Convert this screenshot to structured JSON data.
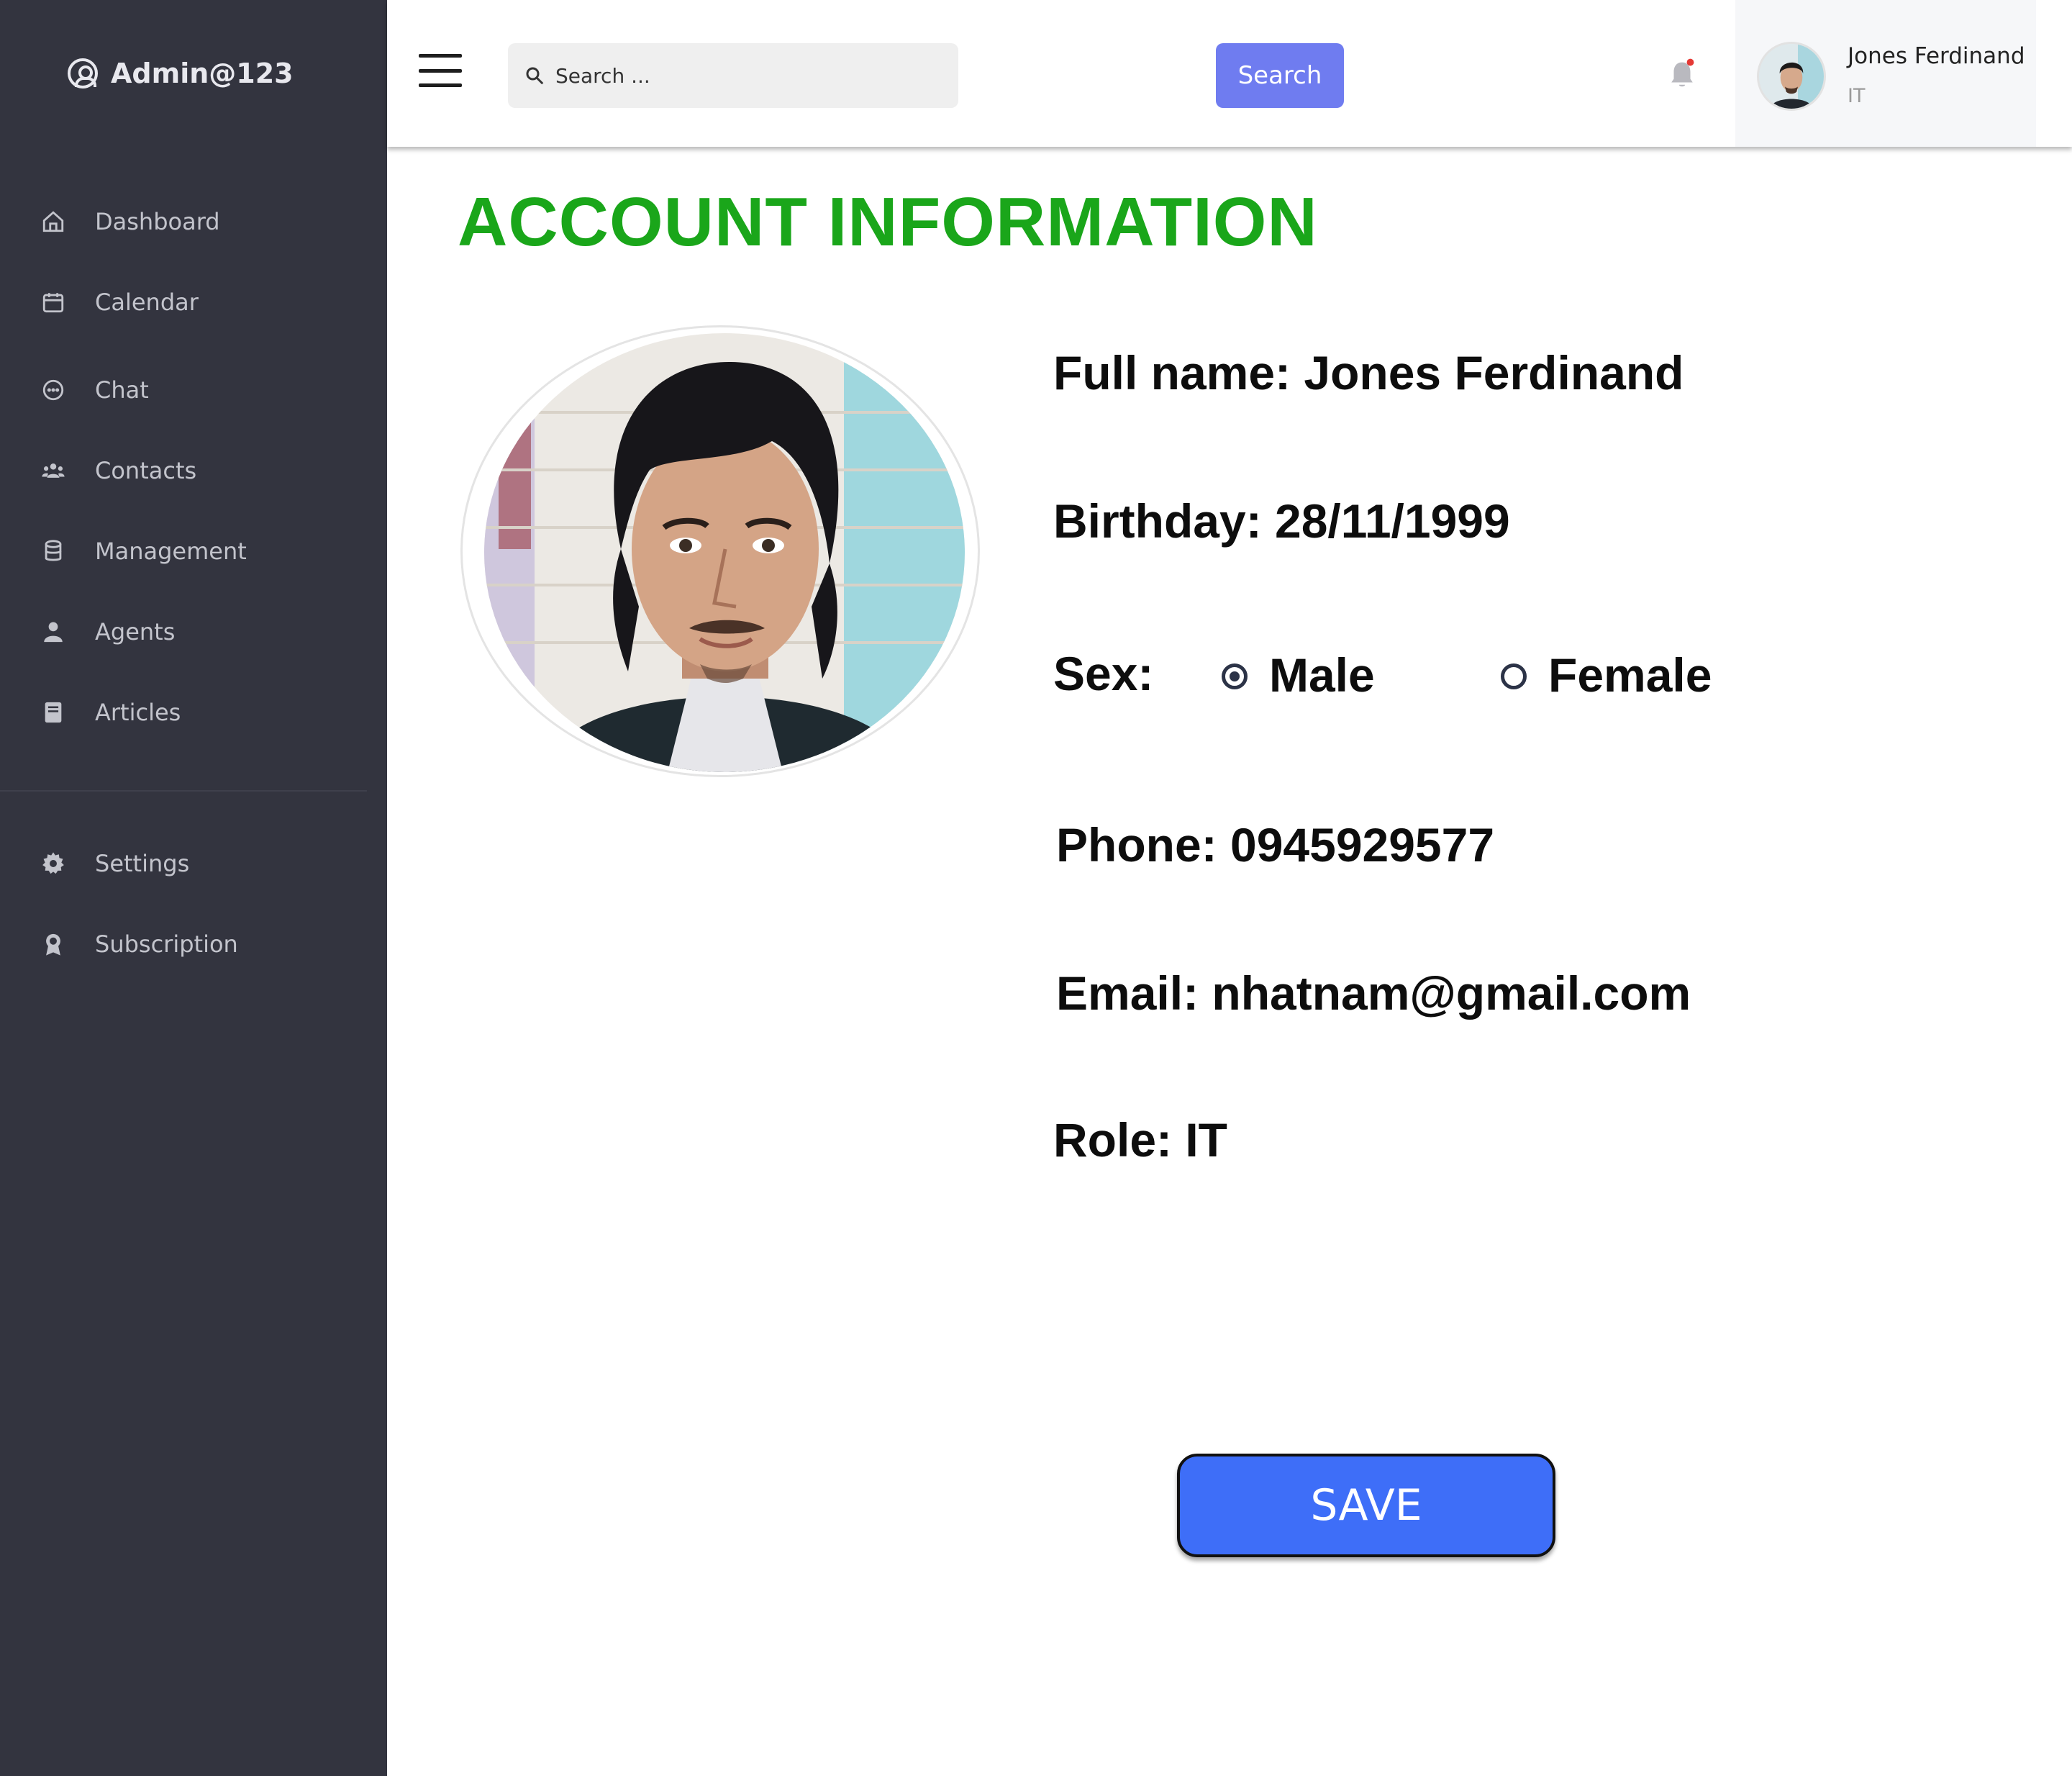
{
  "sidebar": {
    "brand": "Admin@123",
    "items": [
      {
        "label": "Dashboard",
        "icon": "home-icon"
      },
      {
        "label": "Calendar",
        "icon": "calendar-icon"
      },
      {
        "label": "Chat",
        "icon": "chat-icon"
      },
      {
        "label": "Contacts",
        "icon": "contacts-icon"
      },
      {
        "label": "Management",
        "icon": "database-icon"
      },
      {
        "label": "Agents",
        "icon": "agent-icon"
      },
      {
        "label": "Articles",
        "icon": "book-icon"
      }
    ],
    "bottom_items": [
      {
        "label": "Settings",
        "icon": "gear-icon"
      },
      {
        "label": "Subscription",
        "icon": "award-icon"
      }
    ]
  },
  "header": {
    "search_placeholder": "Search ...",
    "search_button": "Search",
    "user_name": "Jones Ferdinand",
    "user_role": "IT"
  },
  "main": {
    "title": "ACCOUNT INFORMATION",
    "full_name": "Full name: Jones Ferdinand",
    "birthday": "Birthday: 28/11/1999",
    "sex_label": "Sex:",
    "sex_options": [
      "Male",
      "Female"
    ],
    "sex_selected": "Male",
    "phone": "Phone: 0945929577",
    "email": "Email: nhatnam@gmail.com",
    "role": "Role: IT",
    "save_button": "SAVE"
  },
  "colors": {
    "sidebar_bg": "#33343f",
    "title_green": "#1aa61a",
    "search_button": "#6f7cf0",
    "save_button": "#3e6ef8",
    "notification_dot": "#e53935"
  }
}
